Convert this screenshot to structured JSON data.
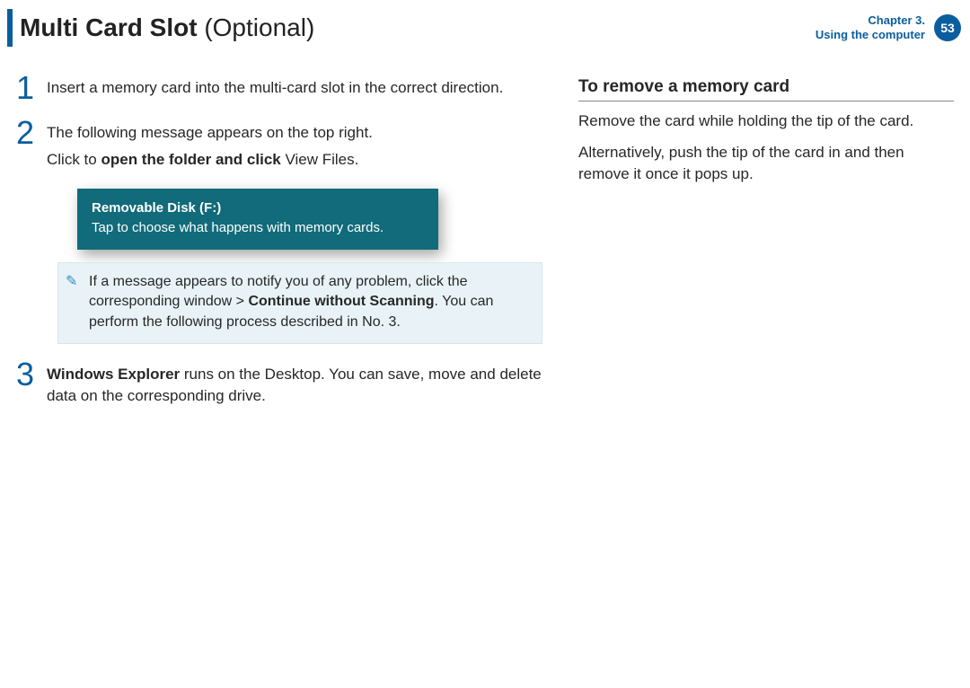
{
  "header": {
    "title_main": "Multi Card Slot",
    "title_suffix": "(Optional)",
    "chapter_line1": "Chapter 3.",
    "chapter_line2": "Using the computer",
    "page_number": "53"
  },
  "left": {
    "steps": [
      {
        "num": "1",
        "paragraphs": [
          {
            "text": "Insert a memory card into the multi-card slot in the correct direction."
          }
        ]
      },
      {
        "num": "2",
        "paragraphs": [
          {
            "text": "The following message appears on the top right."
          },
          {
            "pre": "Click to ",
            "bold": "open the folder and click",
            "post": " View Files."
          }
        ]
      },
      {
        "num": "3",
        "paragraphs": [
          {
            "bold": "Windows Explorer",
            "post": " runs on the Desktop. You can save, move and delete data on the corresponding drive."
          }
        ]
      }
    ],
    "toast": {
      "title": "Removable Disk (F:)",
      "body": "Tap to choose what happens with memory cards."
    },
    "note": {
      "pre": "If a message appears to notify you of any problem, click the corresponding window > ",
      "bold": "Continue without Scanning",
      "post": ". You can perform the following process described in No. 3."
    }
  },
  "right": {
    "heading": "To remove a memory card",
    "p1": "Remove the card while holding the tip of the card.",
    "p2": "Alternatively, push the tip of the card in and then remove it once it pops up."
  }
}
